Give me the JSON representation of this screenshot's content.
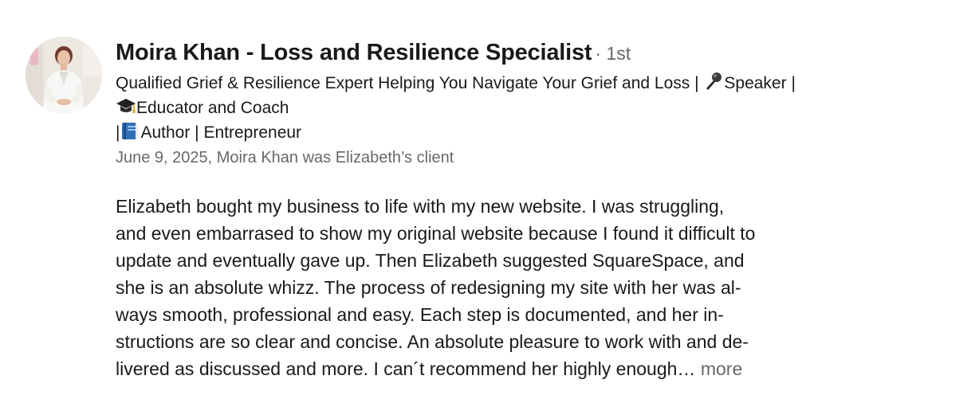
{
  "recommendation": {
    "author_name": "Moira Khan - Loss and Resilience Specialist",
    "connection_degree": "· 1st",
    "headline": {
      "line1_text": "Qualified Grief & Resilience Expert Helping You Navigate Your Grief and Loss | ",
      "line1_icon": "microphone-icon",
      "line1_after": "Speaker |",
      "line2_icon": "graduation-cap-icon",
      "line2_text": "Educator and Coach",
      "line3_before": "|",
      "line3_icon": "blue-book-icon",
      "line3_text": "Author | Entrepreneur"
    },
    "relationship_meta": "June 9, 2025, Moira Khan was Elizabeth’s client",
    "body_lines": [
      "Elizabeth bought my business to life with my new website.  I was struggling,",
      "and even embarrased to show my original website because I found it difficult to",
      "update and eventually gave up.  Then Elizabeth suggested SquareSpace, and",
      "she is an absolute whizz.  The process of redesigning my site with her was al-",
      "ways smooth, professional and easy.  Each step is documented, and her in-",
      "structions are so clear and concise. An absolute pleasure to work with and de-",
      "livered as discussed and more.  I can´t recommend her highly enough…"
    ],
    "more_label": "more"
  },
  "colors": {
    "primary_text": "#1a1a1a",
    "secondary_text": "#666666",
    "background": "#ffffff"
  }
}
